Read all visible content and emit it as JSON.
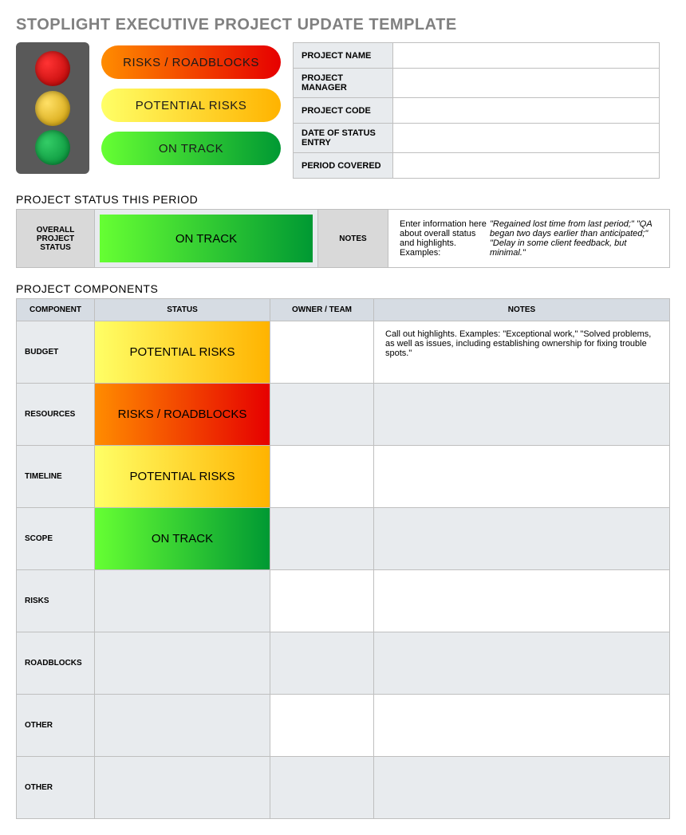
{
  "title": "STOPLIGHT EXECUTIVE PROJECT UPDATE TEMPLATE",
  "legend": {
    "red": "RISKS / ROADBLOCKS",
    "yellow": "POTENTIAL RISKS",
    "green": "ON TRACK"
  },
  "meta": {
    "fields": [
      {
        "label": "PROJECT NAME",
        "value": ""
      },
      {
        "label": "PROJECT MANAGER",
        "value": ""
      },
      {
        "label": "PROJECT CODE",
        "value": ""
      },
      {
        "label": "DATE OF STATUS ENTRY",
        "value": ""
      },
      {
        "label": "PERIOD COVERED",
        "value": ""
      }
    ]
  },
  "status_section": {
    "title": "PROJECT STATUS THIS PERIOD",
    "overall_label": "OVERALL PROJECT STATUS",
    "overall_status": "ON TRACK",
    "notes_label": "NOTES",
    "notes_intro": "Enter information here about overall status and highlights. Examples: ",
    "notes_examples": "\"Regained lost time from last period;\" \"QA began two days earlier than anticipated;\" \"Delay in some client feedback, but minimal.\""
  },
  "components_section": {
    "title": "PROJECT COMPONENTS",
    "headers": {
      "component": "COMPONENT",
      "status": "STATUS",
      "owner": "OWNER / TEAM",
      "notes": "NOTES"
    },
    "rows": [
      {
        "label": "BUDGET",
        "status": "POTENTIAL RISKS",
        "status_class": "sp-yellow",
        "owner": "",
        "notes": "Call out highlights. Examples: \"Exceptional work,\" \"Solved problems, as well as issues, including establishing ownership for fixing trouble spots.\""
      },
      {
        "label": "RESOURCES",
        "status": "RISKS / ROADBLOCKS",
        "status_class": "sp-red",
        "owner": "",
        "notes": ""
      },
      {
        "label": "TIMELINE",
        "status": "POTENTIAL RISKS",
        "status_class": "sp-yellow",
        "owner": "",
        "notes": ""
      },
      {
        "label": "SCOPE",
        "status": "ON TRACK",
        "status_class": "sp-green",
        "owner": "",
        "notes": ""
      },
      {
        "label": "RISKS",
        "status": "",
        "status_class": "",
        "owner": "",
        "notes": ""
      },
      {
        "label": "ROADBLOCKS",
        "status": "",
        "status_class": "",
        "owner": "",
        "notes": ""
      },
      {
        "label": "OTHER",
        "status": "",
        "status_class": "",
        "owner": "",
        "notes": ""
      },
      {
        "label": "OTHER",
        "status": "",
        "status_class": "",
        "owner": "",
        "notes": ""
      }
    ]
  }
}
